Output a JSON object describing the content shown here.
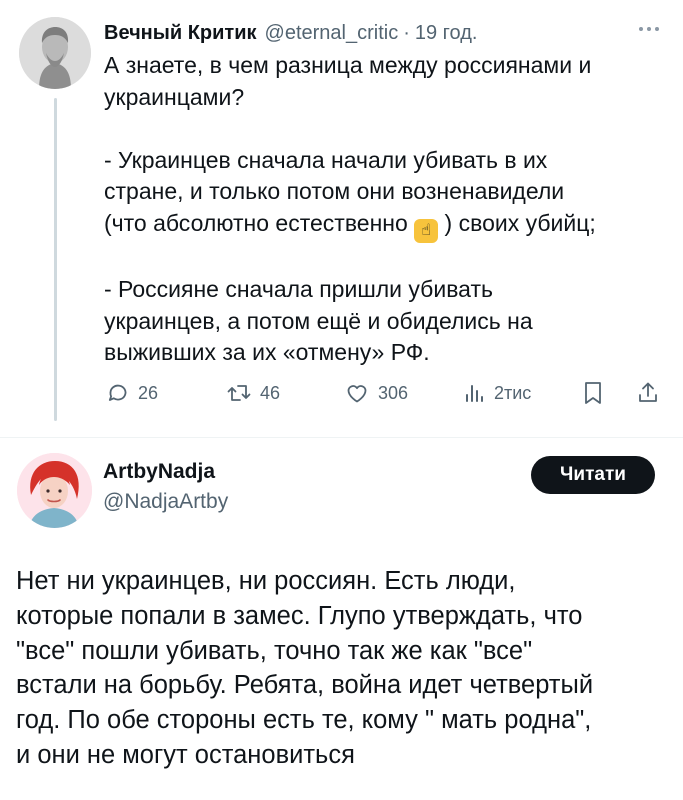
{
  "tweet1": {
    "author_name": "Вечный Критик",
    "handle": "@eternal_critic",
    "separator": "·",
    "time": "19 год.",
    "text_lines": [
      "А знаете, в чем разница между россиянами и",
      "украинцами?",
      "",
      "- Украинцев сначала начали убивать в их",
      "стране, и только потом они возненавидели",
      "",
      "",
      "- Россияне сначала пришли убивать",
      "украинцев, а потом ещё и обиделись на",
      "выживших за их «отмену» РФ."
    ],
    "line_with_emoji": {
      "before": "(что абсолютно естественно ",
      "emoji": "☝",
      "after": " ) своих убийц;"
    },
    "stats": {
      "replies": "26",
      "reposts": "46",
      "likes": "306",
      "views": "2тис"
    }
  },
  "tweet2": {
    "author_name": "ArtbyNadja",
    "handle": "@NadjaArtby",
    "follow_label": "Читати",
    "text_lines": [
      "Нет ни украинцев, ни россиян. Есть люди,",
      "которые попали в замес. Глупо утверждать, что",
      "\"все\" пошли убивать, точно так же как \"все\"",
      "встали на борьбу. Ребята, война идет четвертый",
      "год. По обе стороны есть те, кому \" мать родна\",",
      "и они не могут остановиться"
    ]
  },
  "icons": {
    "more": "more-dots-icon",
    "reply": "reply-icon",
    "repost": "repost-icon",
    "like": "heart-icon",
    "views": "views-icon",
    "bookmark": "bookmark-icon",
    "share": "share-icon"
  },
  "colors": {
    "text": "#0f1419",
    "secondary": "#536471",
    "follow_bg": "#0f1419",
    "thread_line": "#cfd9de"
  }
}
